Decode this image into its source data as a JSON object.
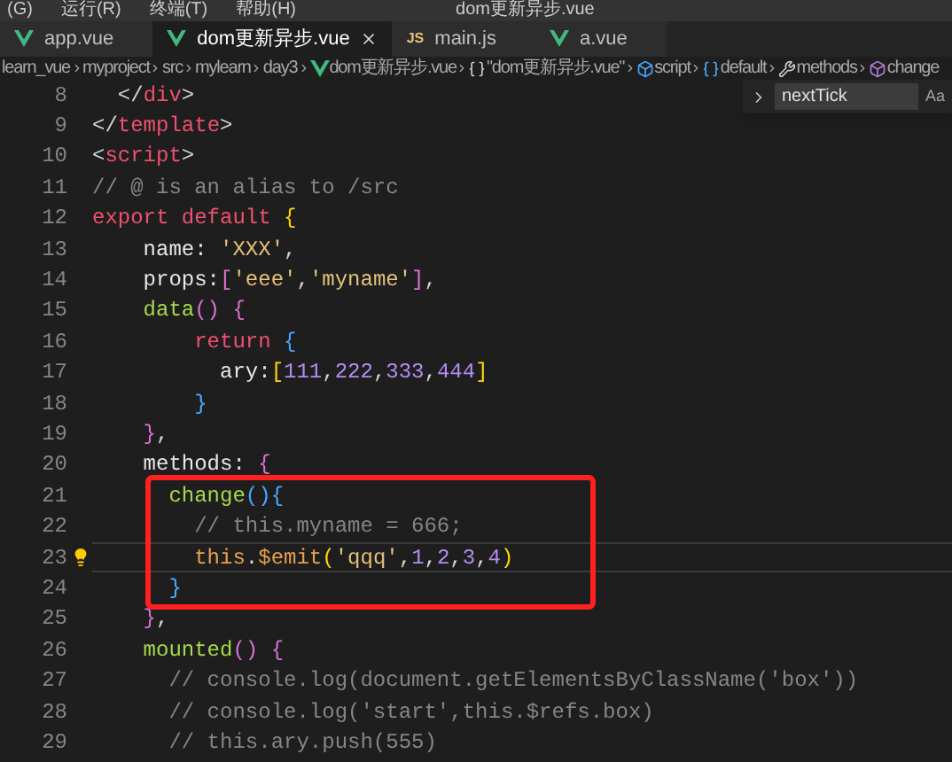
{
  "menu": [
    "(G)",
    "运行(R)",
    "终端(T)",
    "帮助(H)"
  ],
  "window": {
    "title": "dom更新异步.vue"
  },
  "tabs": [
    {
      "label": "app.vue",
      "kind": "vue",
      "selected": false,
      "closable": false
    },
    {
      "label": "dom更新异步.vue",
      "kind": "vue",
      "selected": true,
      "closable": true
    },
    {
      "label": "main.js",
      "kind": "js",
      "badge": "JS",
      "selected": false,
      "closable": false
    },
    {
      "label": "a.vue",
      "kind": "vue",
      "selected": false,
      "closable": false
    }
  ],
  "breadcrumb": [
    {
      "label": "learn_vue",
      "kind": "folder"
    },
    {
      "label": "myproject",
      "kind": "folder"
    },
    {
      "label": "src",
      "kind": "folder"
    },
    {
      "label": "mylearn",
      "kind": "folder"
    },
    {
      "label": "day3",
      "kind": "folder"
    },
    {
      "label": "dom更新异步.vue",
      "kind": "vue"
    },
    {
      "label": "\"dom更新异步.vue\"",
      "kind": "braces"
    },
    {
      "label": "script",
      "kind": "cube"
    },
    {
      "label": "default",
      "kind": "module"
    },
    {
      "label": "methods",
      "kind": "wrench"
    },
    {
      "label": "change",
      "kind": "method"
    }
  ],
  "find": {
    "value": "nextTick",
    "toggle": "Aa"
  },
  "lines": [
    {
      "number": "8",
      "current": false,
      "boxed": false,
      "tokens": [
        {
          "text": "  </",
          "kind": "punct"
        },
        {
          "text": "div",
          "kind": "tag"
        },
        {
          "text": ">",
          "kind": "punct"
        }
      ]
    },
    {
      "number": "9",
      "current": false,
      "boxed": false,
      "tokens": [
        {
          "text": "</",
          "kind": "punct"
        },
        {
          "text": "template",
          "kind": "tag"
        },
        {
          "text": ">",
          "kind": "punct"
        }
      ]
    },
    {
      "number": "10",
      "current": false,
      "boxed": false,
      "tokens": [
        {
          "text": "<",
          "kind": "punct"
        },
        {
          "text": "script",
          "kind": "tag"
        },
        {
          "text": ">",
          "kind": "punct"
        }
      ]
    },
    {
      "number": "11",
      "current": false,
      "boxed": false,
      "tokens": [
        {
          "text": "// @ is an alias to /src",
          "kind": "comment"
        }
      ]
    },
    {
      "number": "12",
      "current": false,
      "boxed": false,
      "tokens": [
        {
          "text": "export default ",
          "kind": "keyword"
        },
        {
          "text": "{",
          "kind": "bracket1"
        }
      ]
    },
    {
      "number": "13",
      "current": false,
      "boxed": false,
      "tokens": [
        {
          "text": "    name: ",
          "kind": "key"
        },
        {
          "text": "'XXX'",
          "kind": "string"
        },
        {
          "text": ",",
          "kind": "punct"
        }
      ]
    },
    {
      "number": "14",
      "current": false,
      "boxed": false,
      "tokens": [
        {
          "text": "    props:",
          "kind": "key"
        },
        {
          "text": "[",
          "kind": "bracket2"
        },
        {
          "text": "'eee'",
          "kind": "string"
        },
        {
          "text": ",",
          "kind": "punct"
        },
        {
          "text": "'myname'",
          "kind": "string"
        },
        {
          "text": "]",
          "kind": "bracket2"
        },
        {
          "text": ",",
          "kind": "punct"
        }
      ]
    },
    {
      "number": "15",
      "current": false,
      "boxed": false,
      "tokens": [
        {
          "text": "    data",
          "kind": "func"
        },
        {
          "text": "() {",
          "kind": "bracket2"
        }
      ]
    },
    {
      "number": "16",
      "current": false,
      "boxed": false,
      "tokens": [
        {
          "text": "        return ",
          "kind": "keyword"
        },
        {
          "text": "{",
          "kind": "bracket3"
        }
      ]
    },
    {
      "number": "17",
      "current": false,
      "boxed": false,
      "tokens": [
        {
          "text": "          ary:",
          "kind": "key"
        },
        {
          "text": "[",
          "kind": "bracket1"
        },
        {
          "text": "111",
          "kind": "number"
        },
        {
          "text": ",",
          "kind": "punct"
        },
        {
          "text": "222",
          "kind": "number"
        },
        {
          "text": ",",
          "kind": "punct"
        },
        {
          "text": "333",
          "kind": "number"
        },
        {
          "text": ",",
          "kind": "punct"
        },
        {
          "text": "444",
          "kind": "number"
        },
        {
          "text": "]",
          "kind": "bracket1"
        }
      ]
    },
    {
      "number": "18",
      "current": false,
      "boxed": false,
      "tokens": [
        {
          "text": "        }",
          "kind": "bracket3"
        }
      ]
    },
    {
      "number": "19",
      "current": false,
      "boxed": false,
      "tokens": [
        {
          "text": "    }",
          "kind": "bracket2"
        },
        {
          "text": ",",
          "kind": "punct"
        }
      ]
    },
    {
      "number": "20",
      "current": false,
      "boxed": false,
      "tokens": [
        {
          "text": "    methods: ",
          "kind": "key"
        },
        {
          "text": "{",
          "kind": "bracket2"
        }
      ]
    },
    {
      "number": "21",
      "current": false,
      "boxed": true,
      "tokens": [
        {
          "text": "      change",
          "kind": "func"
        },
        {
          "text": "(){",
          "kind": "bracket3"
        }
      ]
    },
    {
      "number": "22",
      "current": false,
      "boxed": true,
      "tokens": [
        {
          "text": "        // this.myname = 666;",
          "kind": "comment"
        }
      ]
    },
    {
      "number": "23",
      "current": true,
      "lightbulb_shown": true,
      "boxed": true,
      "tokens": [
        {
          "text": "        this",
          "kind": "this"
        },
        {
          "text": ".",
          "kind": "punct"
        },
        {
          "text": "$emit",
          "kind": "method"
        },
        {
          "text": "(",
          "kind": "bracket1"
        },
        {
          "text": "'qqq'",
          "kind": "string"
        },
        {
          "text": ",",
          "kind": "punct"
        },
        {
          "text": "1",
          "kind": "number"
        },
        {
          "text": ",",
          "kind": "punct"
        },
        {
          "text": "2",
          "kind": "number"
        },
        {
          "text": ",",
          "kind": "punct"
        },
        {
          "text": "3",
          "kind": "number"
        },
        {
          "text": ",",
          "kind": "punct"
        },
        {
          "text": "4",
          "kind": "number"
        },
        {
          "text": ")",
          "kind": "bracket1"
        }
      ]
    },
    {
      "number": "24",
      "current": false,
      "boxed": true,
      "tokens": [
        {
          "text": "      }",
          "kind": "bracket3"
        }
      ]
    },
    {
      "number": "25",
      "current": false,
      "boxed": false,
      "tokens": [
        {
          "text": "    }",
          "kind": "bracket2"
        },
        {
          "text": ",",
          "kind": "punct"
        }
      ]
    },
    {
      "number": "26",
      "current": false,
      "boxed": false,
      "tokens": [
        {
          "text": "    mounted",
          "kind": "func"
        },
        {
          "text": "() {",
          "kind": "bracket2"
        }
      ]
    },
    {
      "number": "27",
      "current": false,
      "boxed": false,
      "tokens": [
        {
          "text": "      // console.log(document.getElementsByClassName('box'))",
          "kind": "comment"
        }
      ]
    },
    {
      "number": "28",
      "current": false,
      "boxed": false,
      "tokens": [
        {
          "text": "      // console.log('start',this.$refs.box)",
          "kind": "comment"
        }
      ]
    },
    {
      "number": "29",
      "current": false,
      "boxed": false,
      "tokens": [
        {
          "text": "      // this.ary.push(555)",
          "kind": "comment"
        }
      ]
    }
  ]
}
